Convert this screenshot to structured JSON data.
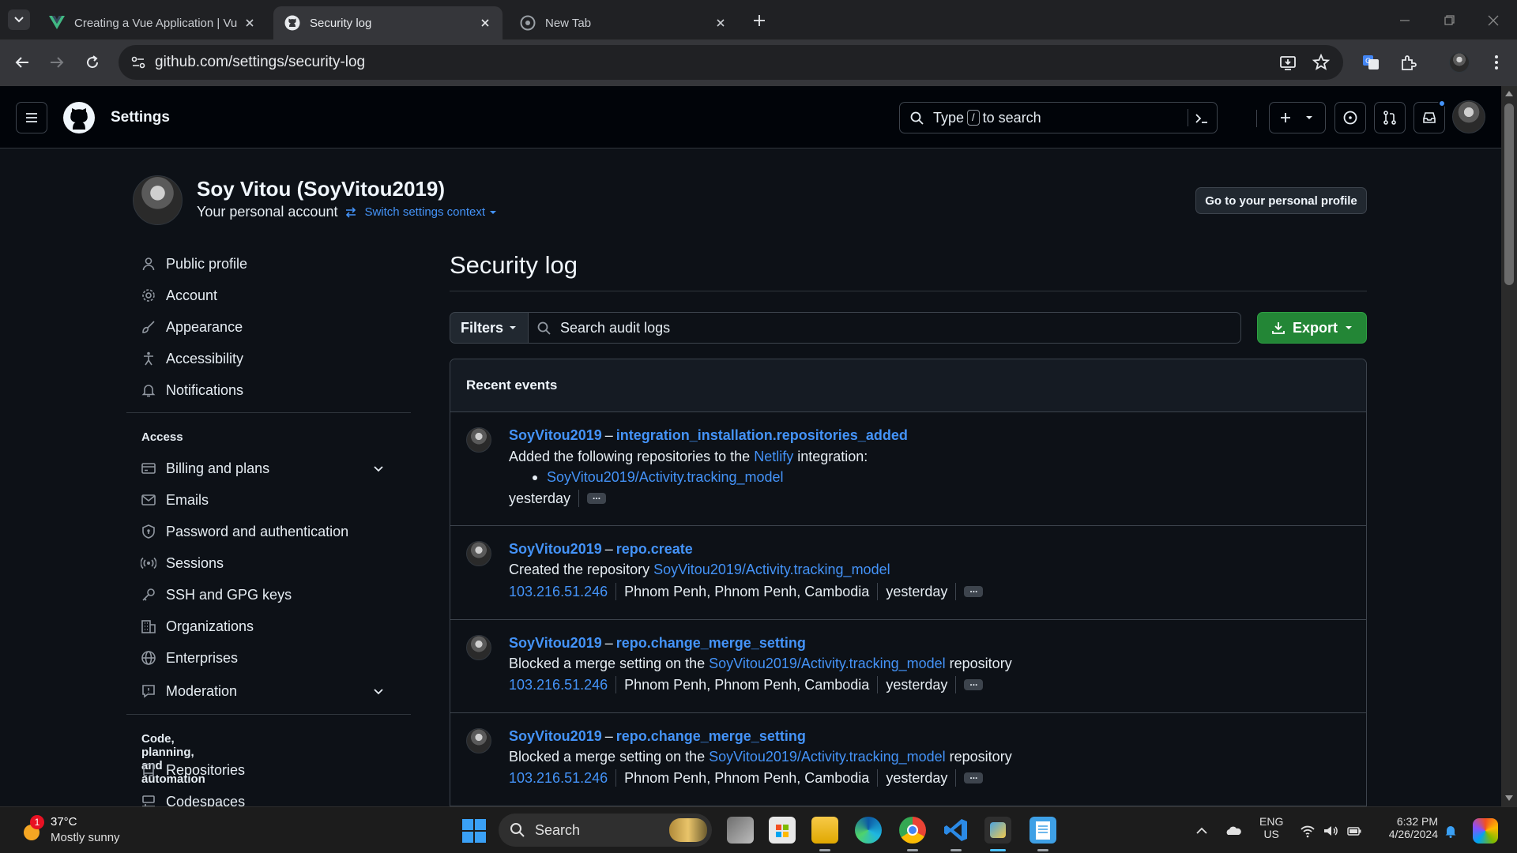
{
  "browser": {
    "tabs": [
      {
        "title": "Creating a Vue Application | Vue",
        "icon": "vue-icon",
        "active": false
      },
      {
        "title": "Security log",
        "icon": "github-icon",
        "active": true
      },
      {
        "title": "New Tab",
        "icon": "chrome-icon",
        "active": false
      }
    ],
    "url": "github.com/settings/security-log"
  },
  "header": {
    "title": "Settings",
    "search_prefix": "Type",
    "search_key": "/",
    "search_suffix": "to search"
  },
  "profile": {
    "name": "Soy Vitou (SoyVitou2019)",
    "subtitle": "Your personal account",
    "switch_context": "Switch settings context",
    "go_profile": "Go to your personal profile"
  },
  "sidebar": {
    "top_items": [
      {
        "label": "Public profile",
        "icon": "person-icon"
      },
      {
        "label": "Account",
        "icon": "gear-icon"
      },
      {
        "label": "Appearance",
        "icon": "paintbrush-icon"
      },
      {
        "label": "Accessibility",
        "icon": "accessibility-icon"
      },
      {
        "label": "Notifications",
        "icon": "bell-icon"
      }
    ],
    "access_heading": "Access",
    "access_items": [
      {
        "label": "Billing and plans",
        "icon": "credit-card-icon",
        "expandable": true
      },
      {
        "label": "Emails",
        "icon": "mail-icon"
      },
      {
        "label": "Password and authentication",
        "icon": "shield-lock-icon"
      },
      {
        "label": "Sessions",
        "icon": "broadcast-icon"
      },
      {
        "label": "SSH and GPG keys",
        "icon": "key-icon"
      },
      {
        "label": "Organizations",
        "icon": "organization-icon"
      },
      {
        "label": "Enterprises",
        "icon": "globe-icon"
      },
      {
        "label": "Moderation",
        "icon": "report-icon",
        "expandable": true
      }
    ],
    "code_heading": "Code, planning, and automation",
    "code_items": [
      {
        "label": "Repositories",
        "icon": "repo-icon"
      },
      {
        "label": "Codespaces",
        "icon": "codespaces-icon"
      }
    ]
  },
  "main": {
    "title": "Security log",
    "filters_label": "Filters",
    "search_placeholder": "Search audit logs",
    "export_label": "Export",
    "events_heading": "Recent events",
    "events": [
      {
        "user": "SoyVitou2019",
        "dash": "–",
        "action": "integration_installation.repositories_added",
        "desc_prefix": "Added the following repositories to the",
        "desc_link": "Netlify",
        "desc_suffix": "integration:",
        "bullet": "SoyVitou2019/Activity.tracking_model",
        "time": "yesterday",
        "more": "..."
      },
      {
        "user": "SoyVitou2019",
        "dash": "–",
        "action": "repo.create",
        "desc_prefix": "Created the repository",
        "desc_link": "SoyVitou2019/Activity.tracking_model",
        "ip": "103.216.51.246",
        "location": "Phnom Penh, Phnom Penh, Cambodia",
        "time": "yesterday",
        "more": "..."
      },
      {
        "user": "SoyVitou2019",
        "dash": "–",
        "action": "repo.change_merge_setting",
        "desc_prefix": "Blocked a merge setting on the",
        "desc_link": "SoyVitou2019/Activity.tracking_model",
        "desc_suffix": "repository",
        "ip": "103.216.51.246",
        "location": "Phnom Penh, Phnom Penh, Cambodia",
        "time": "yesterday",
        "more": "..."
      },
      {
        "user": "SoyVitou2019",
        "dash": "–",
        "action": "repo.change_merge_setting",
        "desc_prefix": "Blocked a merge setting on the",
        "desc_link": "SoyVitou2019/Activity.tracking_model",
        "desc_suffix": "repository",
        "ip": "103.216.51.246",
        "location": "Phnom Penh, Phnom Penh, Cambodia",
        "time": "yesterday",
        "more": "..."
      }
    ]
  },
  "taskbar": {
    "weather_temp": "37°C",
    "weather_desc": "Mostly sunny",
    "weather_badge": "1",
    "search_label": "Search",
    "lang": "ENG",
    "region": "US",
    "time": "6:32 PM",
    "date": "4/26/2024"
  },
  "colors": {
    "link": "#4493f8",
    "export_green": "#238636",
    "page_bg": "#0d1117"
  }
}
